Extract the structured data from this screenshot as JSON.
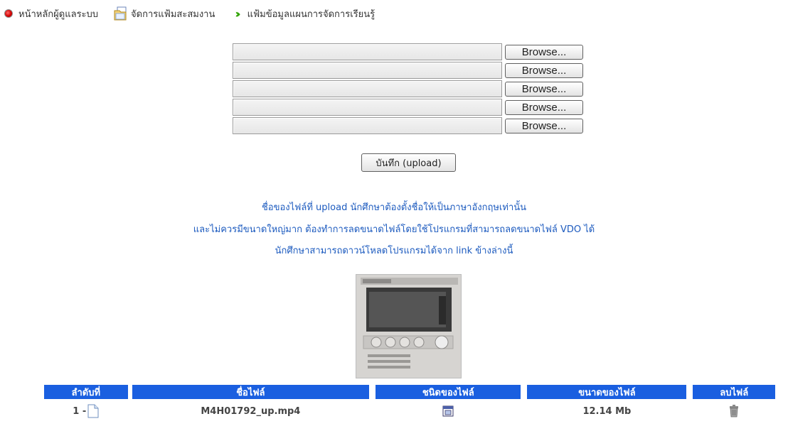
{
  "breadcrumb": {
    "home": "หน้าหลักผู้ดูแลระบบ",
    "portfolio": "จัดการแฟ้มสะสมงาน",
    "current": "แฟ้มข้อมูลแผนการจัดการเรียนรู้"
  },
  "upload": {
    "browse_labels": [
      "Browse...",
      "Browse...",
      "Browse...",
      "Browse...",
      "Browse..."
    ],
    "save_label": "บันทึก (upload)"
  },
  "notes": {
    "line1": "ชื่อของไฟล์ที่ upload นักศึกษาต้องตั้งชื่อให้เป็นภาษาอังกฤษเท่านั้น",
    "line2": "และไม่ควรมีขนาดใหญ่มาก ต้องทำการลดขนาดไฟล์โดยใช้โปรแกรมที่สามารถลดขนาดไฟล์ VDO ได้",
    "line3": "นักศึกษาสามารถดาวน์โหลดโปรแกรมได้จาก link ข้างล่างนี้"
  },
  "table": {
    "headers": {
      "index": "ลำดับที่",
      "name": "ชื่อไฟล์",
      "type": "ชนิดของไฟล์",
      "size": "ขนาดของไฟล์",
      "delete": "ลบไฟล์"
    },
    "rows": [
      {
        "index": "1 -",
        "name": "M4H01792_up.mp4",
        "size": "12.14 Mb"
      }
    ]
  },
  "colors": {
    "header_blue": "#1a5fe0",
    "note_blue": "#1d5bbf",
    "arrow_green": "#2fa400"
  }
}
